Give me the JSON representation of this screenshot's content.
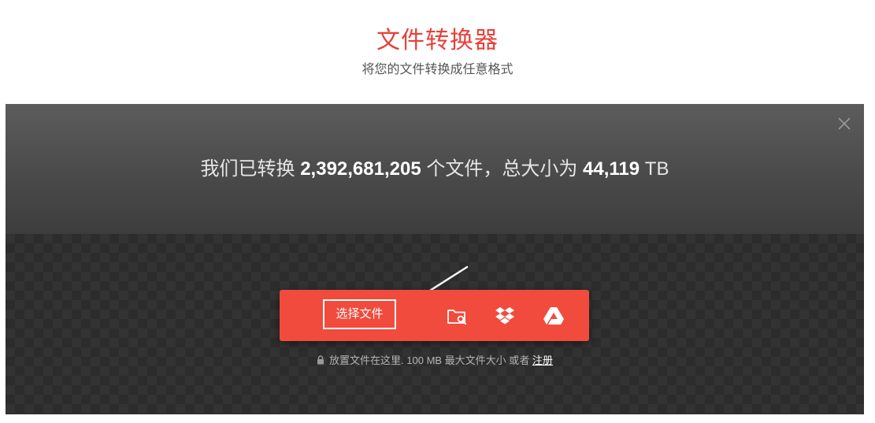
{
  "header": {
    "title": "文件转换器",
    "subtitle": "将您的文件转换成任意格式"
  },
  "stats": {
    "prefix": "我们已转换",
    "file_count": "2,392,681,205",
    "middle": "个文件，总大小为",
    "total_size": "44,119",
    "unit": "TB"
  },
  "upload": {
    "choose_label": "选择文件",
    "icons": [
      "folder-search-icon",
      "dropbox-icon",
      "google-drive-icon"
    ]
  },
  "note": {
    "text": "放置文件在这里. 100 MB 最大文件大小 或者",
    "link": "注册"
  },
  "colors": {
    "accent": "#e8403a",
    "button": "#f04b3d",
    "panel_top": "#4a4a4a",
    "panel_bottom": "#333333"
  }
}
